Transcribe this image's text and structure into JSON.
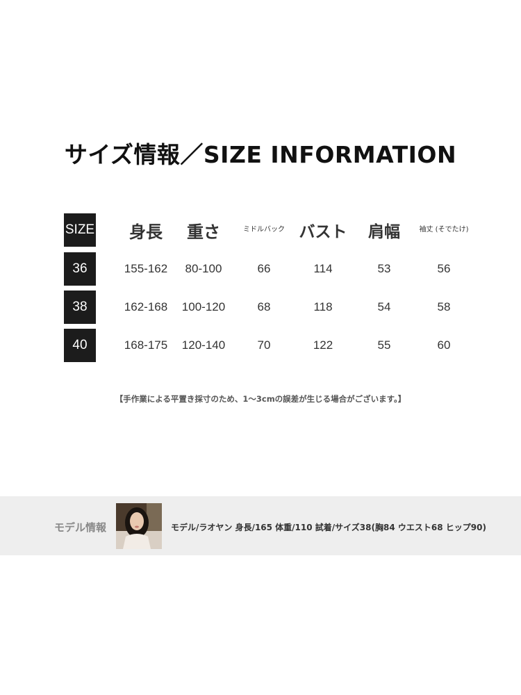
{
  "title": "サイズ情報／SIZE INFORMATION",
  "table": {
    "headers": {
      "size": "SIZE",
      "height": "身長",
      "weight": "重さ",
      "middle_back": "ミドルバック",
      "bust": "バスト",
      "shoulder": "肩幅",
      "sleeve": "袖丈 (そでたけ)"
    },
    "rows": [
      {
        "size": "36",
        "height": "155-162",
        "weight": "80-100",
        "middle_back": "66",
        "bust": "114",
        "shoulder": "53",
        "sleeve": "56"
      },
      {
        "size": "38",
        "height": "162-168",
        "weight": "100-120",
        "middle_back": "68",
        "bust": "118",
        "shoulder": "54",
        "sleeve": "58"
      },
      {
        "size": "40",
        "height": "168-175",
        "weight": "120-140",
        "middle_back": "70",
        "bust": "122",
        "shoulder": "55",
        "sleeve": "60"
      }
    ]
  },
  "note": "【手作業による平置き採寸のため、1～3cmの誤差が生じる場合がございます。】",
  "model": {
    "label": "モデル情報",
    "description": "モデル/ラオヤン 身長/165 体重/110 試着/サイズ38(胸84 ウエスト68 ヒップ90)"
  }
}
